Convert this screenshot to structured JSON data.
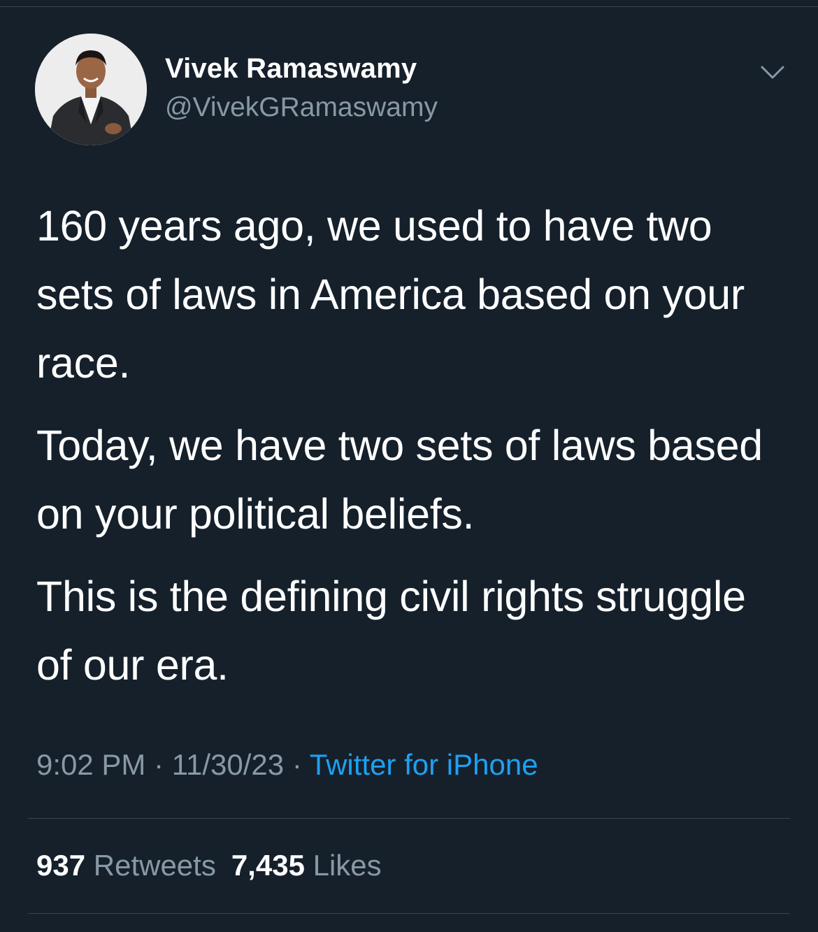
{
  "tweet": {
    "author": {
      "display_name": "Vivek Ramaswamy",
      "handle": "@VivekGRamaswamy"
    },
    "paragraphs": [
      "160 years ago, we used to have two sets of laws in America based on your race.",
      "Today, we have two sets of laws based on your political beliefs.",
      "This is the defining civil rights struggle of our era."
    ],
    "time": "9:02 PM",
    "separator": "·",
    "date": "11/30/23",
    "source": "Twitter for iPhone",
    "stats": {
      "retweets_count": "937",
      "retweets_label": "Retweets",
      "likes_count": "7,435",
      "likes_label": "Likes"
    }
  },
  "icons": {
    "menu_caret": "chevron-down-icon",
    "avatar": "avatar"
  },
  "colors": {
    "background": "#15202b",
    "primary_text": "#ffffff",
    "secondary_text": "#8899a6",
    "link": "#1da1f2",
    "divider": "#38444d"
  }
}
